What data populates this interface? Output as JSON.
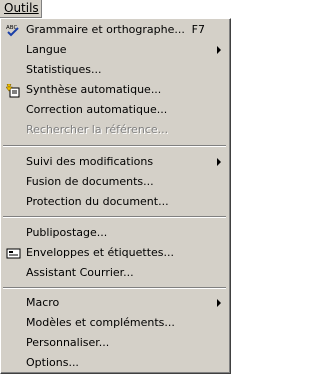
{
  "menu_title": "Outils",
  "items": {
    "grammaire": {
      "label": "Grammaire et orthographe...",
      "shortcut": "F7",
      "icon": "spellcheck-icon"
    },
    "langue": {
      "label": "Langue"
    },
    "statistiques": {
      "label": "Statistiques..."
    },
    "synthese": {
      "label": "Synthèse automatique...",
      "icon": "autosummarize-icon"
    },
    "correction": {
      "label": "Correction automatique..."
    },
    "rechercher": {
      "label": "Rechercher la référence..."
    },
    "suivi": {
      "label": "Suivi des modifications"
    },
    "fusion": {
      "label": "Fusion de documents..."
    },
    "protection": {
      "label": "Protection du document..."
    },
    "publipostage": {
      "label": "Publipostage..."
    },
    "enveloppes": {
      "label": "Enveloppes et étiquettes...",
      "icon": "envelope-icon"
    },
    "assistant": {
      "label": "Assistant Courrier..."
    },
    "macro": {
      "label": "Macro"
    },
    "modeles": {
      "label": "Modèles et compléments..."
    },
    "personnaliser": {
      "label": "Personnaliser..."
    },
    "options": {
      "label": "Options..."
    }
  }
}
